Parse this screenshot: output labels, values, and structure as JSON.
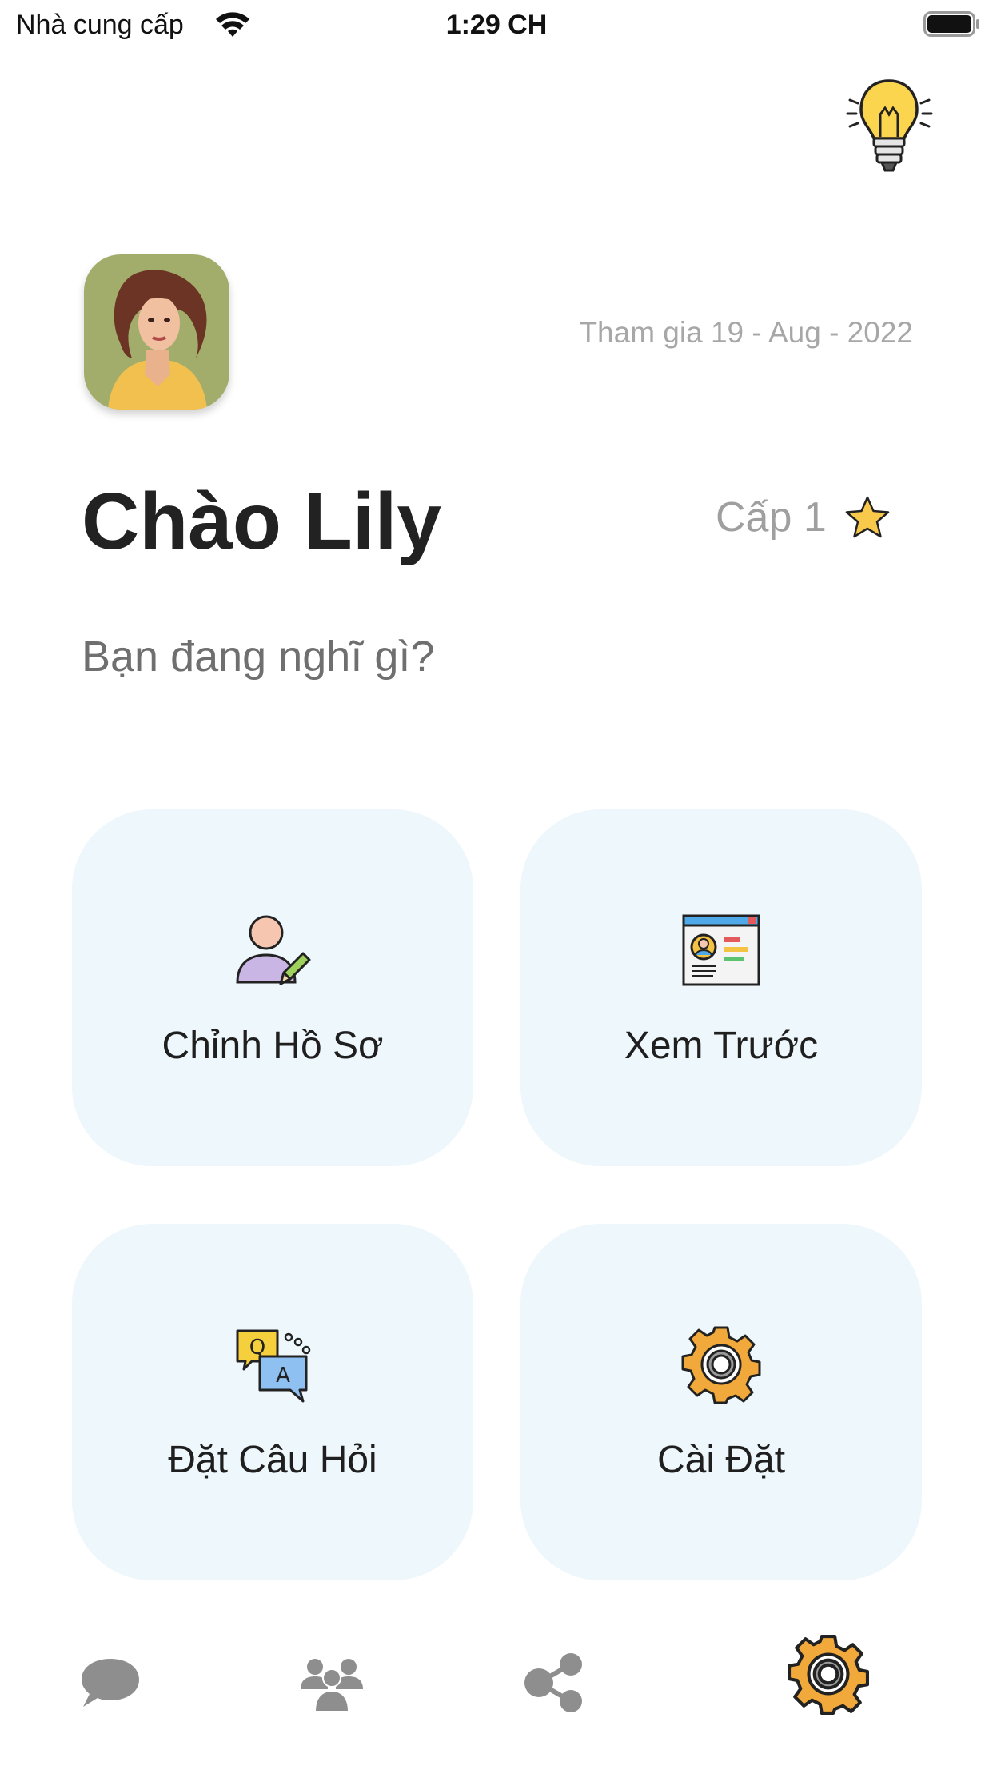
{
  "status_bar": {
    "carrier": "Nhà cung cấp",
    "time": "1:29 CH"
  },
  "profile": {
    "join_date": "Tham gia 19 - Aug - 2022",
    "greeting": "Chào Lily",
    "level": "Cấp 1",
    "prompt": "Bạn đang nghĩ gì?"
  },
  "cards": {
    "edit_profile": {
      "label": "Chỉnh Hồ Sơ",
      "icon": "user-edit-icon"
    },
    "preview": {
      "label": "Xem Trước",
      "icon": "resume-preview-icon"
    },
    "ask_question": {
      "label": "Đặt Câu Hỏi",
      "icon": "qa-chat-icon"
    },
    "settings": {
      "label": "Cài Đặt",
      "icon": "gear-icon"
    }
  },
  "tab_bar": {
    "tabs": [
      {
        "icon": "chat-bubble-icon",
        "active": false
      },
      {
        "icon": "people-group-icon",
        "active": false
      },
      {
        "icon": "share-nodes-icon",
        "active": false
      },
      {
        "icon": "gear-icon",
        "active": true
      }
    ]
  },
  "colors": {
    "card_background": "#eef7fb",
    "inactive_tab": "#8e8e8e",
    "accent_yellow": "#f6c343",
    "gear_orange": "#f2a93b"
  }
}
